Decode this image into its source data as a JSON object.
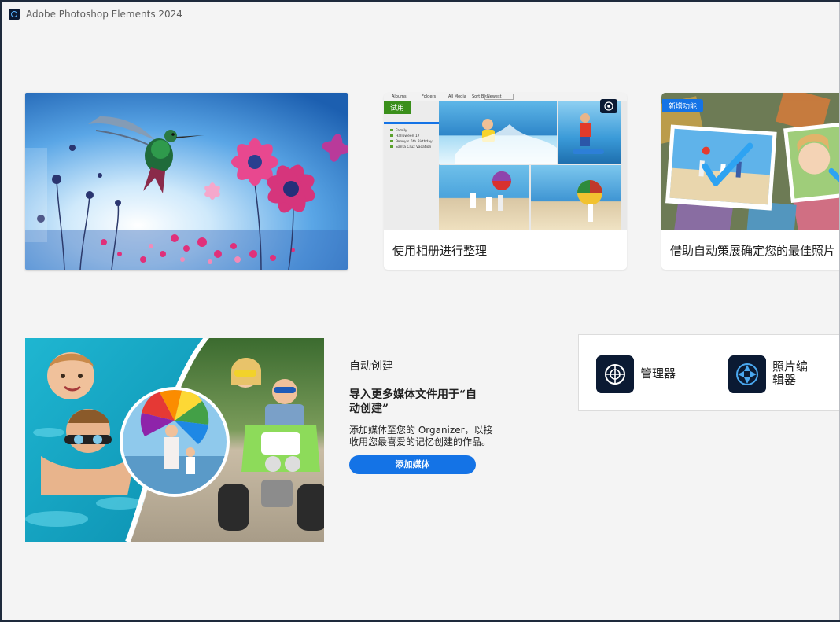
{
  "window": {
    "title": "Adobe Photoshop Elements 2024",
    "icon": "photoshop-elements-app-icon"
  },
  "hero": {
    "image": "hummingbird-and-pink-cosmos-flowers-painting"
  },
  "cards": [
    {
      "id": "albums",
      "tag": "试用",
      "tag_color": "#3a8f1b",
      "caption": "使用相册进行整理",
      "mock": {
        "tabs": [
          "Albums",
          "Folders"
        ],
        "toolbar": [
          "All Media",
          "Sort By:",
          "Newest"
        ],
        "albums": [
          "Family",
          "Halloween 17",
          "Penny's 6th Birthday",
          "Santa Cruz Vacation"
        ]
      }
    },
    {
      "id": "auto-curate",
      "tag": "新增功能",
      "tag_color": "#1473e6",
      "caption": "借助自动策展确定您的最佳照片"
    }
  ],
  "auto_creation": {
    "heading": "自动创建",
    "title": "导入更多媒体文件用于“自动创建”",
    "description": "添加媒体至您的 Organizer，以接收用您最喜爱的记忆创建的作品。",
    "button_label": "添加媒体",
    "accent": "#1473e6",
    "image": "kids-pool-and-quad-bike-collage"
  },
  "launchers": [
    {
      "id": "organizer",
      "label": "管理器",
      "icon": "organizer-icon"
    },
    {
      "id": "photo-editor",
      "label": "照片编辑器",
      "icon": "photo-editor-icon"
    }
  ]
}
